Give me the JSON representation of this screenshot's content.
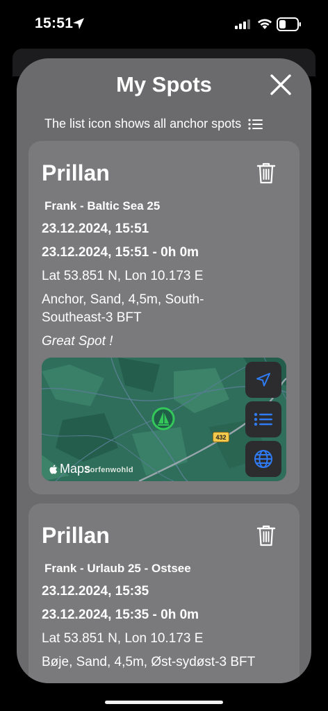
{
  "status": {
    "time": "15:51"
  },
  "sheet": {
    "title": "My Spots",
    "hint": "The list icon shows all anchor spots"
  },
  "spots": [
    {
      "boat": "Prillan",
      "owner_trip": "Frank  - Baltic Sea 25",
      "date": "23.12.2024, 15:51",
      "date_range": "23.12.2024, 15:51 - 0h 0m",
      "position": "Lat 53.851 N, Lon 10.173 E",
      "details": "Anchor, Sand, 4,5m, South-Southeast-3 BFT",
      "note": "Great Spot !",
      "map": {
        "logo_text": "Maps",
        "place_label": "Sorfenwohld",
        "road_number": "432"
      }
    },
    {
      "boat": "Prillan",
      "owner_trip": "Frank  - Urlaub 25 - Ostsee",
      "date": "23.12.2024, 15:35",
      "date_range": "23.12.2024, 15:35 - 0h 0m",
      "position": "Lat 53.851 N, Lon 10.173 E",
      "details": "Bøje, Sand, 4,5m, Øst-sydøst-3 BFT"
    }
  ],
  "colors": {
    "accent": "#2f7bf6",
    "sheet_bg": "#6b6b6d",
    "card_bg": "#7a7a7c",
    "marker": "#34c759"
  }
}
